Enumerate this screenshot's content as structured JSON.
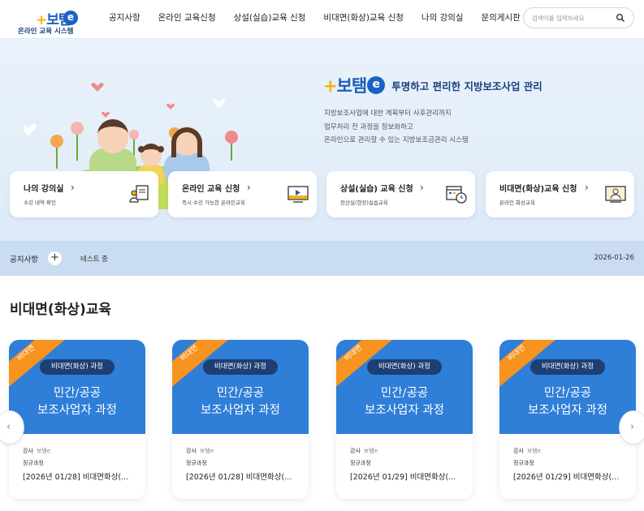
{
  "header": {
    "logo_mark": "보탬",
    "logo_e": "e",
    "logo_sub": "온라인 교육 시스템",
    "nav": [
      "공지사항",
      "온라인 교육신청",
      "상설(실습)교육 신청",
      "비대면(화상)교육 신청",
      "나의 강의실",
      "문의게시판"
    ],
    "search_placeholder": "검색어를 입력하세요",
    "search_icon": "search-icon"
  },
  "hero": {
    "brand": "보탬",
    "brand_e": "e",
    "tagline": "투명하고 편리한 지방보조사업 관리",
    "desc": [
      "지방보조사업에 대한 계획부터 사후관리까지",
      "업무처리 전 과정을 정보화하고",
      "온라인으로 관리할 수 있는 지방보조금관리 시스템"
    ]
  },
  "quick_cards": [
    {
      "title": "나의 강의실",
      "sub": "수강 내역 확인",
      "icon": "classroom-icon"
    },
    {
      "title": "온라인 교육 신청",
      "sub": "즉시 수강 가능한 온라인교육",
      "icon": "video-monitor-icon"
    },
    {
      "title": "상설(실습) 교육 신청",
      "sub": "전산실(현장)실습교육",
      "icon": "calendar-clock-icon"
    },
    {
      "title": "비대면(화상)교육 신청",
      "sub": "온라인 화상교육",
      "icon": "video-call-icon"
    }
  ],
  "notice": {
    "label": "공지사항",
    "text": "테스트 중",
    "date": "2026-01-26"
  },
  "section": {
    "title": "비대면(화상)교육"
  },
  "courses": [
    {
      "ribbon": "비대면",
      "pill": "비대면(화상) 과정",
      "line1": "민간/공공",
      "line2": "보조사업자 과정",
      "inst_label": "강사",
      "inst_name": "보탬e",
      "type": "정규과정",
      "title": "[2026년 01/28] 비대면화상(..."
    },
    {
      "ribbon": "비대면",
      "pill": "비대면(화상) 과정",
      "line1": "민간/공공",
      "line2": "보조사업자 과정",
      "inst_label": "강사",
      "inst_name": "보탬e",
      "type": "정규과정",
      "title": "[2026년 01/28] 비대면화상(..."
    },
    {
      "ribbon": "비대면",
      "pill": "비대면(화상) 과정",
      "line1": "민간/공공",
      "line2": "보조사업자 과정",
      "inst_label": "강사",
      "inst_name": "보탬e",
      "type": "정규과정",
      "title": "[2026년 01/29] 비대면화상(..."
    },
    {
      "ribbon": "비대면",
      "pill": "비대면(화상) 과정",
      "line1": "민간/공공",
      "line2": "보조사업자 과정",
      "inst_label": "강사",
      "inst_name": "보탬e",
      "type": "정규과정",
      "title": "[2026년 01/29] 비대면화상(..."
    }
  ],
  "colors": {
    "brand_blue": "#1b5fb8",
    "brand_yellow": "#f4b400",
    "card_blue": "#2f7ed8",
    "ribbon_orange": "#f7931e",
    "pill_navy": "#1e3f73",
    "notice_bg": "#c9dcf2"
  }
}
